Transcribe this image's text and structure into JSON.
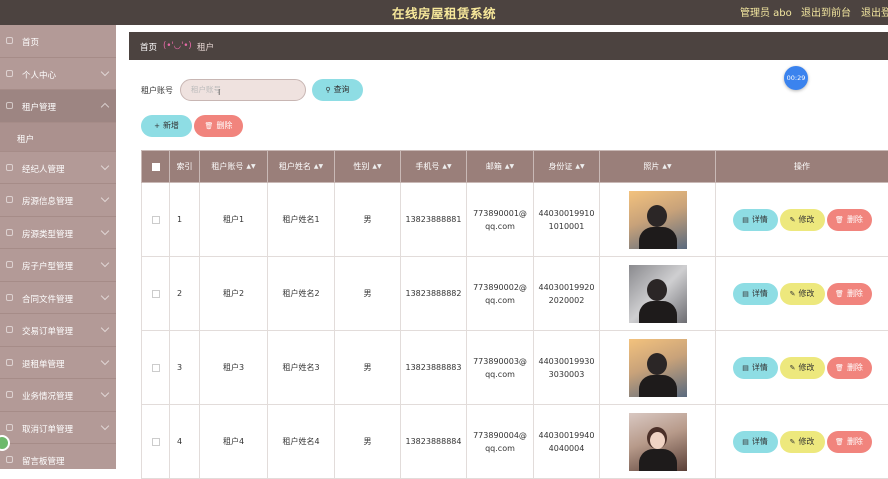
{
  "header": {
    "title": "在线房屋租赁系统",
    "admin_label": "管理员 abo",
    "back_link": "退出到前台",
    "logout_link": "退出登"
  },
  "sidebar": {
    "items": [
      {
        "label": "首页"
      },
      {
        "label": "个人中心"
      },
      {
        "label": "租户管理"
      },
      {
        "label": "租户",
        "sub": true
      },
      {
        "label": "经纪人管理"
      },
      {
        "label": "房源信息管理"
      },
      {
        "label": "房源类型管理"
      },
      {
        "label": "房子户型管理"
      },
      {
        "label": "合同文件管理"
      },
      {
        "label": "交易订单管理"
      },
      {
        "label": "退租单管理"
      },
      {
        "label": "业务情况管理"
      },
      {
        "label": "取消订单管理"
      },
      {
        "label": "留言板管理"
      }
    ]
  },
  "breadcrumb": {
    "home": "首页",
    "face": "(•'◡'•)",
    "current": "租户"
  },
  "timer": "00:29",
  "search": {
    "label": "租户账号",
    "placeholder": "租户账号",
    "query_button": "查询",
    "query_icon": "search-icon"
  },
  "actions": {
    "add_button": "新增",
    "delete_button": "删除"
  },
  "table": {
    "headers": [
      "",
      "索引",
      "租户账号",
      "租户姓名",
      "性别",
      "手机号",
      "邮箱",
      "身份证",
      "照片",
      "操作"
    ],
    "rows": [
      {
        "index": "1",
        "account": "租户1",
        "name": "租户姓名1",
        "gender": "男",
        "phone": "13823888881",
        "email": "773890001@qq.com",
        "id_card": "440300199101010001",
        "photo": "a"
      },
      {
        "index": "2",
        "account": "租户2",
        "name": "租户姓名2",
        "gender": "男",
        "phone": "13823888882",
        "email": "773890002@qq.com",
        "id_card": "440300199202020002",
        "photo": "b"
      },
      {
        "index": "3",
        "account": "租户3",
        "name": "租户姓名3",
        "gender": "男",
        "phone": "13823888883",
        "email": "773890003@qq.com",
        "id_card": "440300199303030003",
        "photo": "a"
      },
      {
        "index": "4",
        "account": "租户4",
        "name": "租户姓名4",
        "gender": "男",
        "phone": "13823888884",
        "email": "773890004@qq.com",
        "id_card": "440300199404040004",
        "photo": "c"
      }
    ],
    "row_buttons": {
      "detail": "详情",
      "edit": "修改",
      "remove": "删除"
    }
  },
  "colors": {
    "topbar": "#4c4340",
    "sidebar": "#b39a97",
    "table_header": "#9a7f7a",
    "accent_cyan": "#8edde4",
    "accent_yellow": "#ede87d",
    "accent_red": "#f1847d"
  }
}
